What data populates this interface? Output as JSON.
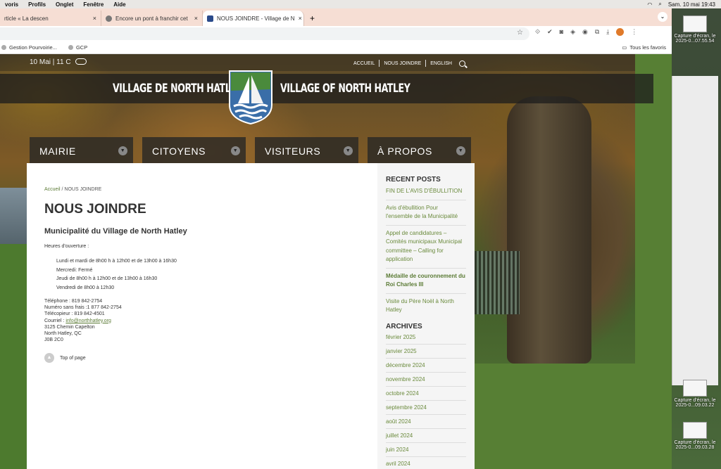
{
  "menubar": {
    "items": [
      "voris",
      "Profils",
      "Onglet",
      "Fenêtre",
      "Aide"
    ],
    "datetime": "Sam. 10 mai 19:43"
  },
  "tabs": [
    {
      "label": "rticle « La descen"
    },
    {
      "label": "Encore un pont à franchir cet"
    },
    {
      "label": "NOUS JOINDRE - Village de N"
    }
  ],
  "bookmarks": {
    "items": [
      "Gestion Pourvoirie...",
      "GCP"
    ],
    "all": "Tous les favoris"
  },
  "desktop": {
    "icons": [
      {
        "label1": "Capture d'écran, le",
        "label2": "2025-0...07.55.54"
      },
      {
        "label1": "Capture d'écran, le",
        "label2": "2025-0...09.03.22"
      },
      {
        "label1": "Capture d'écran, le",
        "label2": "2025-0...09.03.28"
      }
    ]
  },
  "site": {
    "weather": "10 Mai  |  11 C",
    "topnav": [
      "ACCUEIL",
      "NOUS JOINDRE",
      "ENGLISH"
    ],
    "title_fr": "VILLAGE DE NORTH HATLEY",
    "title_en": "VILLAGE OF NORTH HATLEY",
    "mainnav": [
      {
        "label": "MAIRIE",
        "color": "#8a9a4a"
      },
      {
        "label": "CITOYENS",
        "color": "#2f6fa8"
      },
      {
        "label": "VISITEURS",
        "color": "#c9a227"
      },
      {
        "label": "À PROPOS",
        "color": "#a8322c"
      }
    ]
  },
  "content": {
    "breadcrumb_home": "Accueil",
    "breadcrumb_current": " / NOUS JOINDRE",
    "title": "NOUS JOINDRE",
    "subtitle": "Municipalité du Village de North Hatley",
    "hours_label": "Heures d'ouverture :",
    "hours": [
      "Lundi et mardi de 8h00 h à 12h00 et de 13h00 à 16h30",
      "Mercredi: Fermé",
      "Jeudi de 8h00 h à 12h00 et de 13h00 à 16h30",
      "Vendredi de 8h00 à 12h30"
    ],
    "phone": "Téléphone : 819 842-2754",
    "tollfree": "Numéro sans frais :1 877 842-2754",
    "fax": "Télécopieur : 819 842-4501",
    "email_label": "Courriel : ",
    "email": "info@northhatley.org",
    "address1": "3125 Chemin Capelton",
    "address2": "North Hatley, QC",
    "postal": "J0B 2C0",
    "top_of_page": "Top of page"
  },
  "sidebar": {
    "recent_heading": "RECENT POSTS",
    "posts": [
      "FIN DE L'AVIS D'ÉBULLITION",
      "Avis d'ébullition Pour l'ensemble de la Municipalité",
      "Appel de candidatures – Comités municipaux Municipal committee – Calling for application",
      "Médaille de couronnement du Roi Charles III",
      "Visite du Père Noël à North Hatley"
    ],
    "archives_heading": "ARCHIVES",
    "archives": [
      "février 2025",
      "janvier 2025",
      "décembre 2024",
      "novembre 2024",
      "octobre 2024",
      "septembre 2024",
      "août 2024",
      "juillet 2024",
      "juin 2024",
      "avril 2024"
    ]
  }
}
